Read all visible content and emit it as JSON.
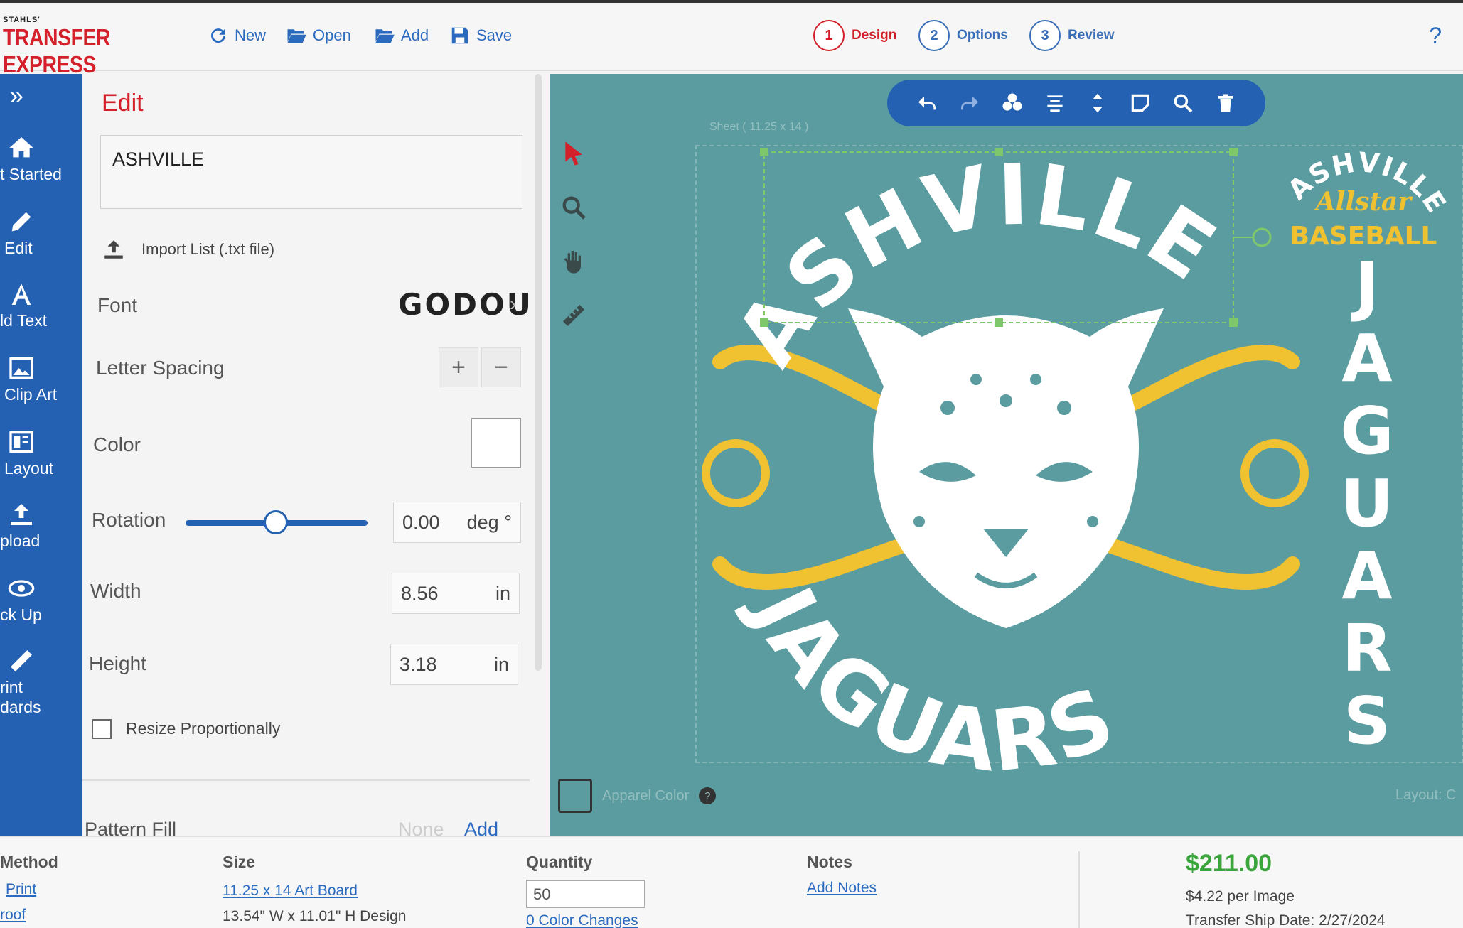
{
  "header": {
    "logo_small": "STAHLS'",
    "logo_main": "TRANSFER EXPRESS",
    "tools": [
      {
        "label": "New",
        "icon": "refresh-icon"
      },
      {
        "label": "Open",
        "icon": "folder-open-icon"
      },
      {
        "label": "Add",
        "icon": "folder-add-icon"
      },
      {
        "label": "Save",
        "icon": "floppy-disk-icon"
      }
    ],
    "steps": [
      {
        "num": "1",
        "label": "Design",
        "active": true
      },
      {
        "num": "2",
        "label": "Options"
      },
      {
        "num": "3",
        "label": "Review"
      }
    ],
    "help": "?"
  },
  "nav": {
    "expand": "»",
    "items": [
      {
        "label": "t Started",
        "icon": "home-icon"
      },
      {
        "label": "Edit",
        "icon": "pencil-icon",
        "active": true
      },
      {
        "label": "ld Text",
        "icon": "text-a-icon"
      },
      {
        "label": "Clip Art",
        "icon": "image-icon"
      },
      {
        "label": "Layout",
        "icon": "layout-icon"
      },
      {
        "label": "pload",
        "icon": "upload-icon"
      },
      {
        "label": "ck Up",
        "icon": "eye-icon"
      },
      {
        "label_1": "rint",
        "label_2": "dards",
        "icon": "ruler-icon"
      }
    ]
  },
  "panel": {
    "title": "Edit",
    "text_value": "ASHVILLE",
    "import_label": "Import List (.txt file)",
    "font_label": "Font",
    "font_value": "GODOU",
    "letter_spacing_label": "Letter Spacing",
    "plus": "+",
    "minus": "−",
    "color_label": "Color",
    "rotation_label": "Rotation",
    "rotation_value": "0.00",
    "rotation_unit": "deg °",
    "rotation_slider_fraction": 0.5,
    "width_label": "Width",
    "width_value": "8.56",
    "width_unit": "in",
    "height_label": "Height",
    "height_value": "3.18",
    "height_unit": "in",
    "resize_label": "Resize Proportionally",
    "pattern_label": "Pattern Fill",
    "pattern_none": "None",
    "pattern_add": "Add"
  },
  "canvas": {
    "background": "#5a9c9f",
    "sheet_label": "Sheet ( 11.25 x 14 )",
    "apparel_label": "Apparel Color",
    "layout_label": "Layout: C",
    "design": {
      "arc_top": "ASHVILLE",
      "arc_bottom": "JAGUARS",
      "side_top": "ASHVILLE",
      "side_script": "Allstar",
      "side_sub": "BASEBALL",
      "side_vertical": "JAGUARS",
      "white": "#ffffff",
      "gold": "#f0c232"
    },
    "toolbar_icons": [
      "undo-icon",
      "redo-icon",
      "arrange-icon",
      "align-icon",
      "center-icon",
      "layer-icon",
      "zoom-icon",
      "trash-icon"
    ]
  },
  "bottom": {
    "method_head": "Method",
    "method_link": "Print",
    "method_link2": "roof",
    "size_head": "Size",
    "size_link": "11.25 x 14 Art Board",
    "size_detail": "13.54\" W x 11.01\" H Design",
    "qty_head": "Quantity",
    "qty_value": "50",
    "color_changes": "0 Color Changes",
    "notes_head": "Notes",
    "notes_link": "Add Notes",
    "price": "$211.00",
    "per_image": "$4.22 per Image",
    "ship_date": "Transfer Ship Date: 2/27/2024"
  }
}
